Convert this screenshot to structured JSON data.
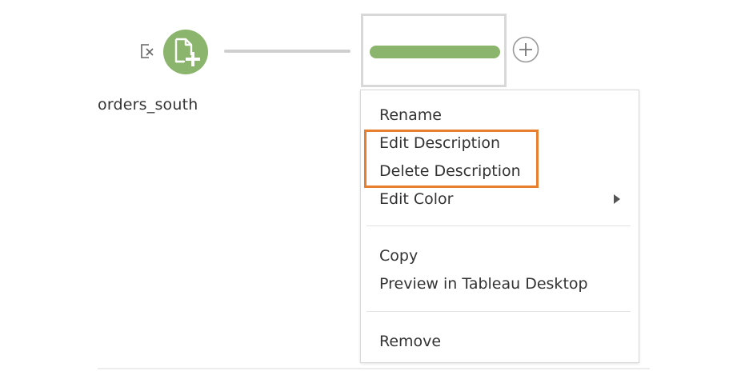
{
  "flow": {
    "input_node": {
      "label": "orders_south",
      "color": "#8bb46c",
      "icon": "file-add-icon",
      "status_icon": "disconnected-icon"
    },
    "step_node": {
      "color": "#8bb46c",
      "add_icon": "plus-circle-icon"
    }
  },
  "context_menu": {
    "items": [
      {
        "label": "Rename"
      },
      {
        "label": "Edit Description",
        "highlighted": true
      },
      {
        "label": "Delete Description",
        "highlighted": true
      },
      {
        "label": "Edit Color",
        "has_submenu": true
      },
      {
        "label": "Copy"
      },
      {
        "label": "Preview in Tableau Desktop"
      },
      {
        "label": "Remove"
      }
    ],
    "highlight_color": "#e87f2e"
  }
}
